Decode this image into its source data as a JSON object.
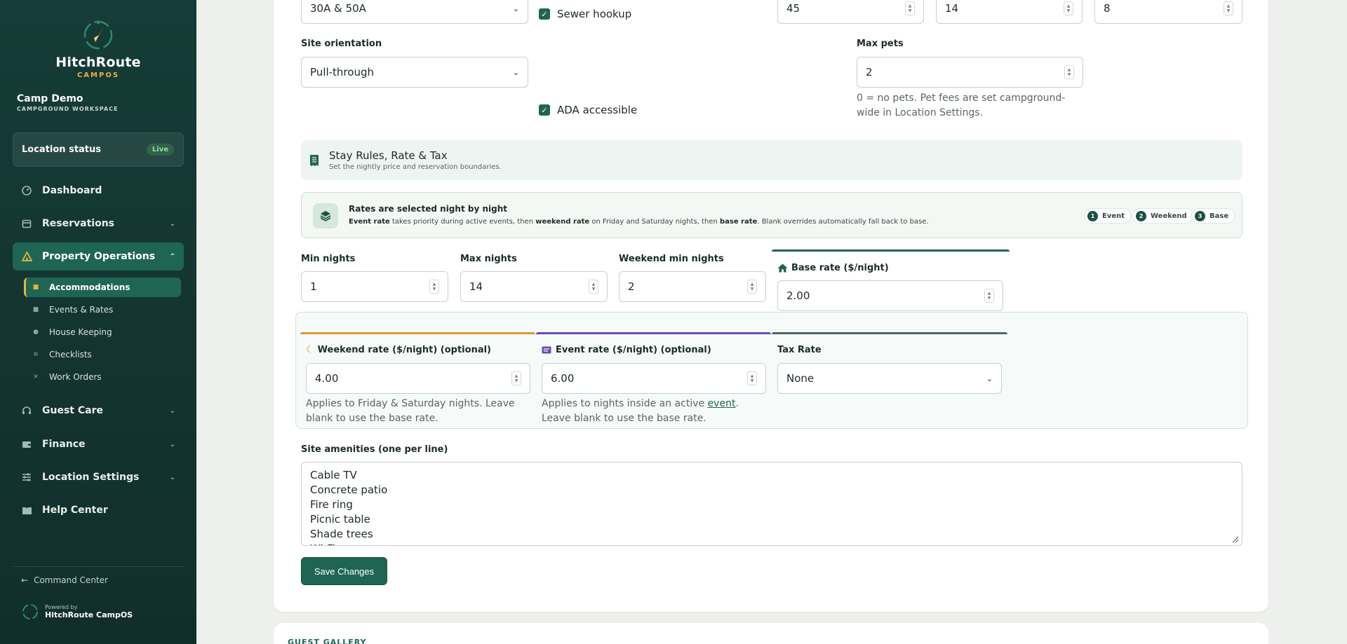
{
  "brand": {
    "name": "HitchRoute",
    "sub": "CAMPOS"
  },
  "workspace": {
    "name": "Camp Demo",
    "sub": "CAMPGROUND WORKSPACE"
  },
  "location_status": {
    "label": "Location status",
    "badge": "Live"
  },
  "nav": {
    "dashboard": "Dashboard",
    "reservations": "Reservations",
    "property_operations": "Property Operations",
    "sub": [
      "Accommodations",
      "Events & Rates",
      "House Keeping",
      "Checklists",
      "Work Orders"
    ],
    "guest_care": "Guest Care",
    "finance": "Finance",
    "location_settings": "Location Settings",
    "help_center": "Help Center"
  },
  "footer": {
    "command_center": "Command Center",
    "powered_by": "Powered by",
    "product": "HitchRoute CampOS"
  },
  "top_row": {
    "power_value": "30A & 50A",
    "sewer_label": "Sewer hookup",
    "num1": "45",
    "num2": "14",
    "num3": "8"
  },
  "orientation": {
    "label": "Site orientation",
    "value": "Pull-through"
  },
  "pets": {
    "label": "Max pets",
    "value": "2",
    "help": "0 = no pets. Pet fees are set campground-wide in Location Settings."
  },
  "ada_label": "ADA accessible",
  "stay_section": {
    "title": "Stay Rules, Rate & Tax",
    "subtitle": "Set the nightly price and reservation boundaries."
  },
  "rates_info": {
    "title": "Rates are selected night by night",
    "desc_a": "Event rate",
    "desc_b": " takes priority during active events, then ",
    "desc_c": "weekend rate",
    "desc_d": " on Friday and Saturday nights, then ",
    "desc_e": "base rate",
    "desc_f": ". Blank overrides automatically fall back to base.",
    "chips": [
      {
        "n": "1",
        "label": "Event"
      },
      {
        "n": "2",
        "label": "Weekend"
      },
      {
        "n": "3",
        "label": "Base"
      }
    ]
  },
  "min_nights": {
    "label": "Min nights",
    "value": "1"
  },
  "max_nights": {
    "label": "Max nights",
    "value": "14"
  },
  "weekend_min": {
    "label": "Weekend min nights",
    "value": "2"
  },
  "base_rate": {
    "label": "Base rate ($/night)",
    "value": "2.00"
  },
  "weekend_rate": {
    "label": "Weekend rate ($/night) (optional)",
    "value": "4.00",
    "help": "Applies to Friday & Saturday nights. Leave blank to use the base rate."
  },
  "event_rate": {
    "label": "Event rate ($/night) (optional)",
    "value": "6.00",
    "help_a": "Applies to nights inside an active ",
    "help_link": "event",
    "help_b": ". Leave blank to use the base rate."
  },
  "tax": {
    "label": "Tax Rate",
    "value": "None"
  },
  "amenities": {
    "label": "Site amenities (one per line)",
    "value": "Cable TV\nConcrete patio\nFire ring\nPicnic table\nShade trees\nWi-Fi"
  },
  "save_label": "Save Changes",
  "gallery_label": "GUEST GALLERY",
  "colors": {
    "primary": "#1f6553",
    "sidebar": "#153c38",
    "accent": "#e9b23c",
    "weekend": "#d99a2b",
    "event": "#6a4bb5",
    "tax": "#4d6470"
  }
}
